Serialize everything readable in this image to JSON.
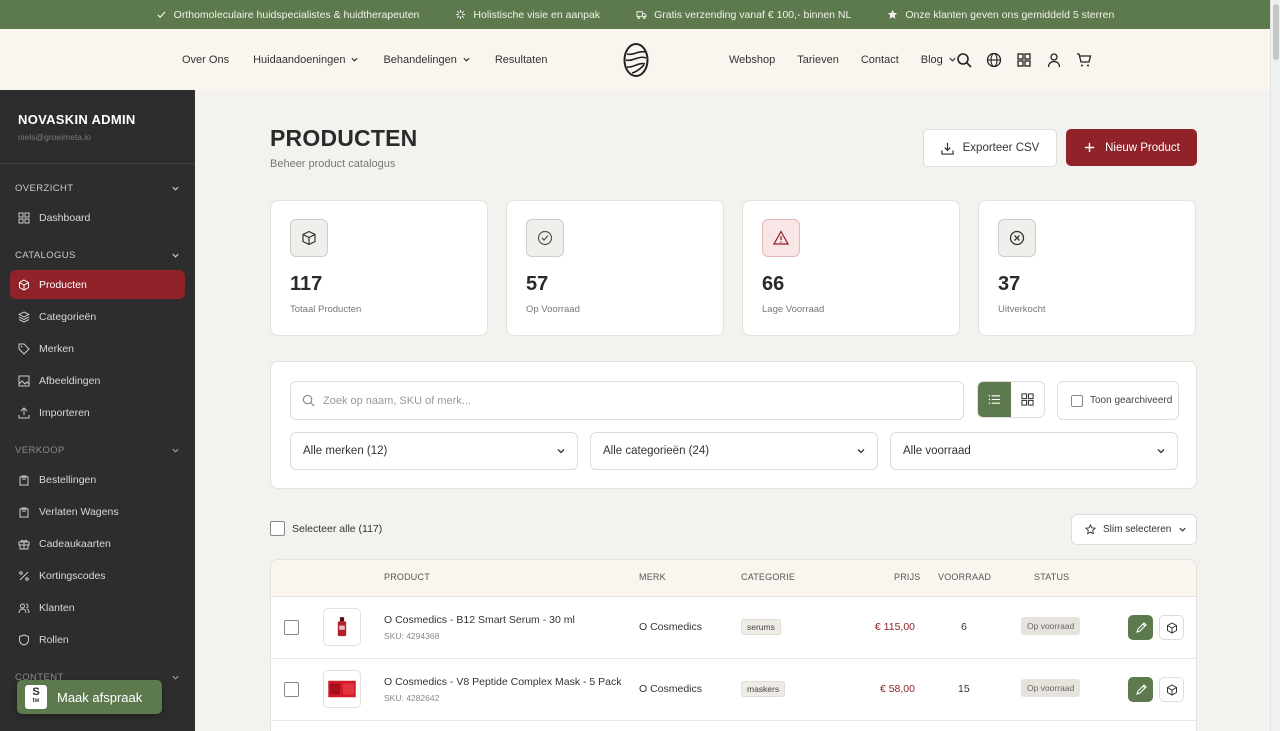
{
  "topbar": {
    "items": [
      {
        "icon": "check-icon",
        "text": "Orthomoleculaire huidspecialistes & huidtherapeuten"
      },
      {
        "icon": "sparkle-icon",
        "text": "Holistische visie en aanpak"
      },
      {
        "icon": "truck-icon",
        "text": "Gratis verzending vanaf € 100,- binnen NL"
      },
      {
        "icon": "star-icon",
        "text": "Onze klanten geven ons gemiddeld 5 sterren"
      }
    ]
  },
  "nav": {
    "left": [
      "Over Ons",
      "Huidaandoeningen",
      "Behandelingen",
      "Resultaten"
    ],
    "right": [
      "Webshop",
      "Tarieven",
      "Contact",
      "Blog"
    ],
    "icons": [
      "search-icon",
      "globe-icon",
      "grid-icon",
      "user-icon",
      "cart-icon"
    ]
  },
  "sidebar": {
    "brand": "NOVASKIN ADMIN",
    "email": "niels@groeimeta.io",
    "sections": [
      {
        "label": "OVERZICHT",
        "items": [
          "Dashboard"
        ]
      },
      {
        "label": "CATALOGUS",
        "items": [
          "Producten",
          "Categorieën",
          "Merken",
          "Afbeeldingen",
          "Importeren"
        ]
      },
      {
        "label": "VERKOOP",
        "items": [
          "Bestellingen",
          "Verlaten Wagens",
          "Cadeaukaarten",
          "Kortingscodes",
          "Klanten",
          "Rollen"
        ]
      },
      {
        "label": "CONTENT",
        "items": []
      }
    ],
    "active": "Producten"
  },
  "fab": {
    "logo_top": "S",
    "logo_bottom": "tw",
    "label": "Maak afspraak"
  },
  "header": {
    "title": "PRODUCTEN",
    "subtitle": "Beheer product catalogus",
    "export_label": "Exporteer CSV",
    "new_label": "Nieuw Product"
  },
  "stats": [
    {
      "value": "117",
      "label": "Totaal Producten",
      "icon": "box-icon"
    },
    {
      "value": "57",
      "label": "Op Voorraad",
      "icon": "check-circle-icon"
    },
    {
      "value": "66",
      "label": "Lage Voorraad",
      "icon": "warning-icon"
    },
    {
      "value": "37",
      "label": "Uitverkocht",
      "icon": "x-circle-icon"
    }
  ],
  "filters": {
    "search_placeholder": "Zoek op naam, SKU of merk...",
    "archived_label": "Toon gearchiveerd",
    "brand_select": "Alle merken (12)",
    "category_select": "Alle categorieën (24)",
    "stock_select": "Alle voorraad"
  },
  "bulk": {
    "select_all": "Selecteer alle (117)",
    "smart_select": "Slim selecteren"
  },
  "table": {
    "headers": {
      "product": "PRODUCT",
      "brand": "MERK",
      "category": "CATEGORIE",
      "price": "PRIJS",
      "stock": "VOORRAAD",
      "status": "STATUS"
    },
    "rows": [
      {
        "name": "O Cosmedics - B12 Smart Serum - 30 ml",
        "sku": "SKU: 4294368",
        "brand": "O Cosmedics",
        "category": "serums",
        "price": "€ 115,00",
        "stock": "6",
        "status": "Op voorraad"
      },
      {
        "name": "O Cosmedics - V8 Peptide Complex Mask - 5 Pack",
        "sku": "SKU: 4282642",
        "brand": "O Cosmedics",
        "category": "maskers",
        "price": "€ 58,00",
        "stock": "15",
        "status": "Op voorraad"
      }
    ]
  },
  "colors": {
    "green": "#5d7a4f",
    "burgundy": "#8f2329",
    "sidebar": "#2d2d2d"
  }
}
